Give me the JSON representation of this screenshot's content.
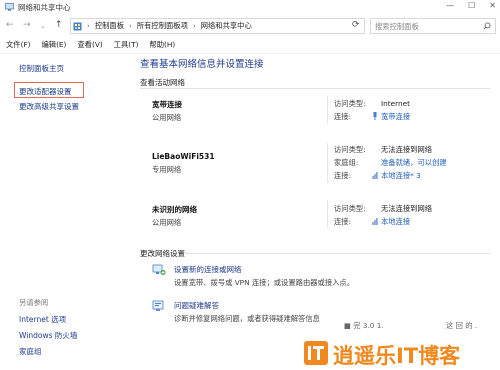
{
  "window": {
    "title": "网络和共享中心",
    "controls": [
      "—",
      "☐",
      "✕"
    ]
  },
  "address": {
    "crumbs": [
      "控制面板",
      "所有控制面板项",
      "网络和共享中心"
    ],
    "search_placeholder": "搜索控制面板"
  },
  "menu": [
    "文件(F)",
    "编辑(E)",
    "查看(V)",
    "工具(T)",
    "帮助(H)"
  ],
  "sidebar": {
    "links": [
      "控制面板主页",
      "更改适配器设置",
      "更改高级共享设置"
    ],
    "see_also_heading": "另请参阅",
    "see_also": [
      "Internet 选项",
      "Windows 防火墙",
      "家庭组"
    ]
  },
  "main": {
    "title": "查看基本网络信息并设置连接",
    "active_heading": "查看活动网络",
    "networks": [
      {
        "name": "宽带连接",
        "type": "公用网络",
        "rows": [
          {
            "label": "访问类型:",
            "value": "Internet"
          },
          {
            "label": "连接:",
            "link": "宽带连接"
          }
        ]
      },
      {
        "name": "LieBaoWiFi531",
        "type": "专用网络",
        "rows": [
          {
            "label": "访问类型:",
            "value": "无法连接到网络"
          },
          {
            "label": "家庭组:",
            "link": "准备就绪，可以创建"
          },
          {
            "label": "连接:",
            "link": "本地连接* 3"
          }
        ]
      },
      {
        "name": "未识别的网络",
        "type": "公用网络",
        "rows": [
          {
            "label": "访问类型:",
            "value": "无法连接到网络"
          },
          {
            "label": "连接:",
            "link": "本地连接"
          }
        ]
      }
    ],
    "change_heading": "更改网络设置",
    "tasks": [
      {
        "link": "设置新的连接或网络",
        "desc": "设置宽带、拨号或 VPN 连接；或设置路由器或接入点。"
      },
      {
        "link": "问题疑难解答",
        "desc": "诊断并修复网络问题，或者获得疑难解答信息"
      }
    ]
  },
  "watermark": {
    "partial_text": "■ 完 3.0 1.",
    "partial_text2": "这 回 的 .",
    "brand": "逍遥乐IT博客"
  }
}
